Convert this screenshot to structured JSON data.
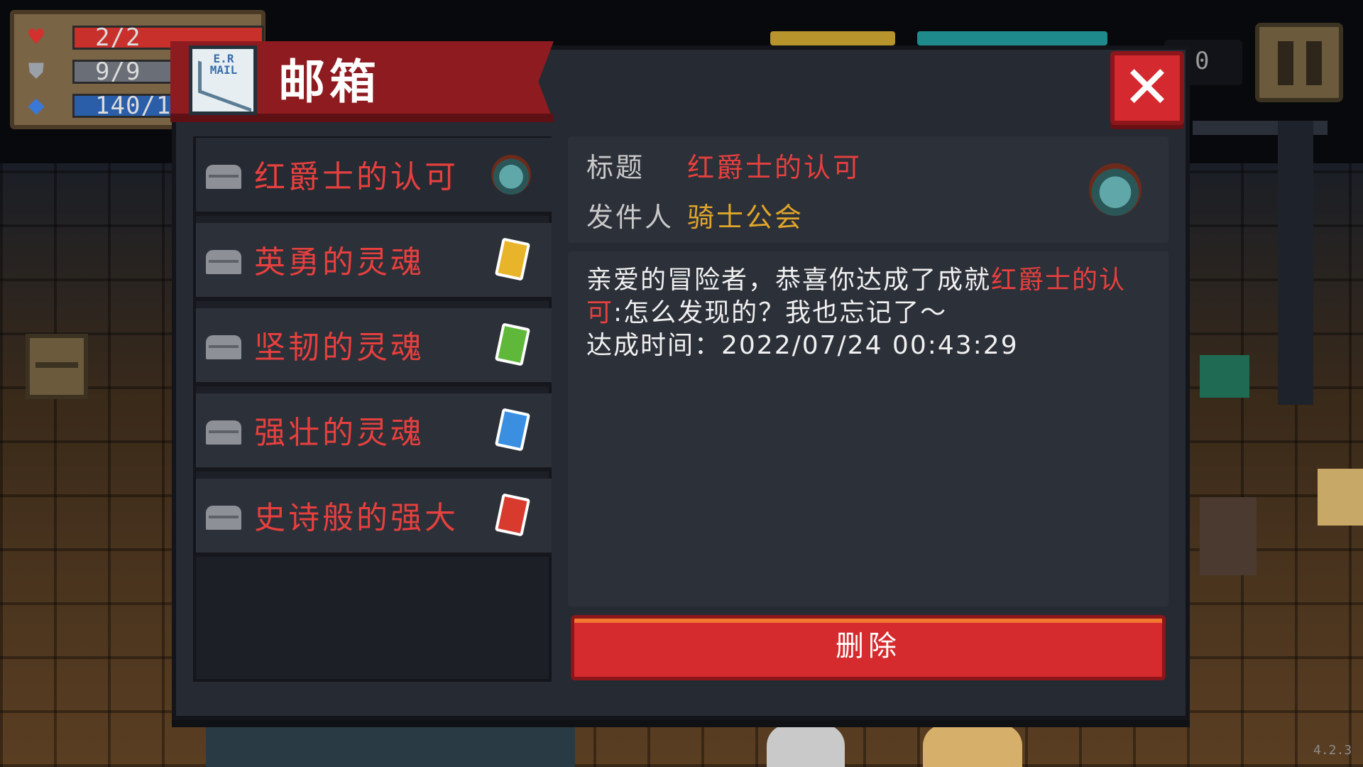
{
  "hud": {
    "health": "2/2",
    "armor": "9/9",
    "energy": "140/1",
    "coins": "0",
    "version": "4.2.3"
  },
  "mailbox": {
    "title": "邮箱",
    "mail_icon_text": "E.R MAIL",
    "items": [
      {
        "label": "红爵士的认可",
        "badge": "helmet-icon"
      },
      {
        "label": "英勇的灵魂",
        "badge": "gold-card-icon"
      },
      {
        "label": "坚韧的灵魂",
        "badge": "green-card-icon"
      },
      {
        "label": "强壮的灵魂",
        "badge": "blue-card-icon"
      },
      {
        "label": "史诗般的强大",
        "badge": "red-card-icon"
      }
    ],
    "selected_index": 0,
    "detail": {
      "title_label": "标题",
      "title_value": "红爵士的认可",
      "sender_label": "发件人",
      "sender_value": "骑士公会",
      "body_prefix": "亲爱的冒险者，恭喜你达成了成就",
      "body_highlight": "红爵士的认可",
      "body_suffix": ":怎么发现的？我也忘记了～",
      "time_line": "达成时间：2022/07/24 00:43:29"
    },
    "delete_label": "删除"
  },
  "colors": {
    "accent_red": "#e6403e",
    "sender_gold": "#e0a62a",
    "header_red": "#8e1b1f",
    "button_red": "#d52a2e",
    "card_gold": "#e8b42a",
    "card_green": "#5fb83a",
    "card_blue": "#3a8fe0",
    "card_red": "#d83a2e"
  }
}
